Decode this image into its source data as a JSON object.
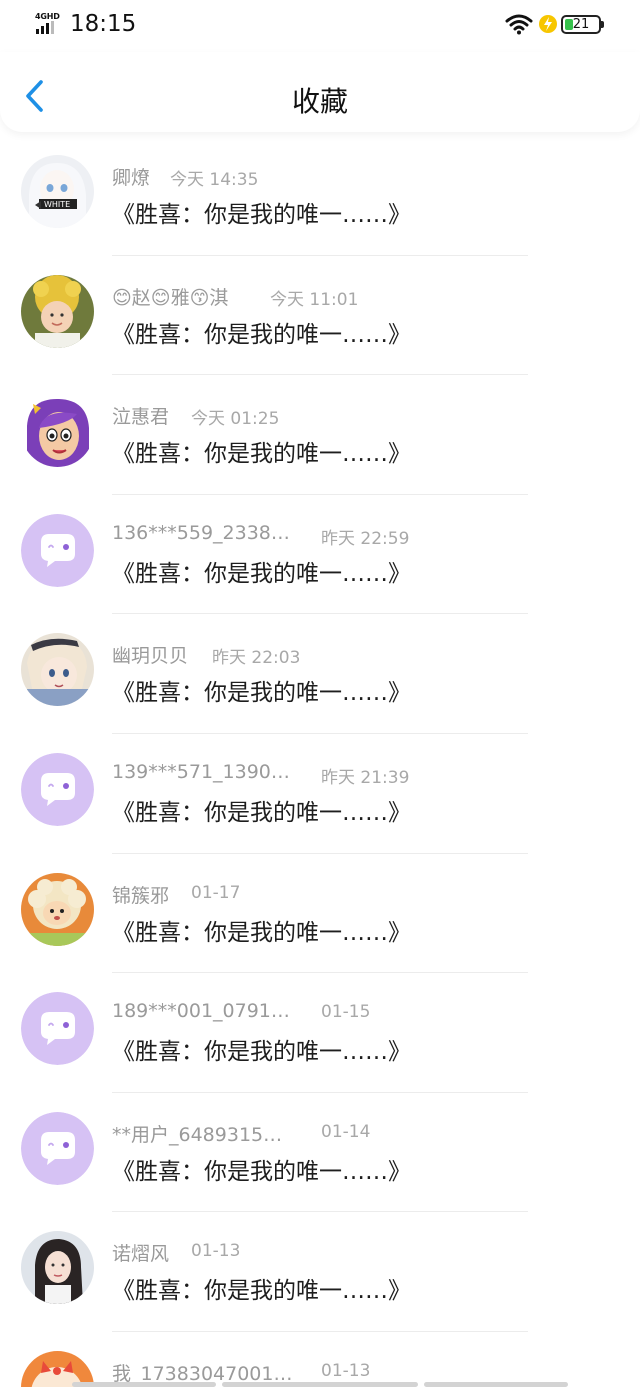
{
  "status_bar": {
    "network": "4GHD",
    "time": "18:15",
    "battery": "21"
  },
  "nav": {
    "back_icon": "chevron-left-icon",
    "title": "收藏",
    "accent_color": "#1e90e6"
  },
  "favorites": [
    {
      "name": "卿燎",
      "time": "今天 14:35",
      "text": "《胜喜：你是我的唯一……》",
      "avatar": "white-hair-anime"
    },
    {
      "name": "😊赵😊雅😙淇",
      "time": "今天 11:01",
      "text": "《胜喜：你是我的唯一……》",
      "avatar": "child-flower-hat"
    },
    {
      "name": "泣惠君",
      "time": "今天 01:25",
      "text": "《胜喜：你是我的唯一……》",
      "avatar": "purple-hair-cartoon"
    },
    {
      "name": "136***559_2338…",
      "time": "昨天 22:59",
      "text": "《胜喜：你是我的唯一……》",
      "avatar": "default-chat-bubble"
    },
    {
      "name": "幽玥贝贝",
      "time": "昨天 22:03",
      "text": "《胜喜：你是我的唯一……》",
      "avatar": "anime-character"
    },
    {
      "name": "139***571_1390…",
      "time": "昨天 21:39",
      "text": "《胜喜：你是我的唯一……》",
      "avatar": "default-chat-bubble"
    },
    {
      "name": "锦簇邪",
      "time": "01-17",
      "text": "《胜喜：你是我的唯一……》",
      "avatar": "sheep-cartoon"
    },
    {
      "name": "189***001_0791…",
      "time": "01-15",
      "text": "《胜喜：你是我的唯一……》",
      "avatar": "default-chat-bubble"
    },
    {
      "name": "**用户_6489315…",
      "time": "01-14",
      "text": "《胜喜：你是我的唯一……》",
      "avatar": "default-chat-bubble"
    },
    {
      "name": "诺熠风",
      "time": "01-13",
      "text": "《胜喜：你是我的唯一……》",
      "avatar": "woman-photo"
    },
    {
      "name": "我_17383047001…",
      "time": "01-13",
      "text": "",
      "avatar": "orange-cartoon"
    }
  ]
}
